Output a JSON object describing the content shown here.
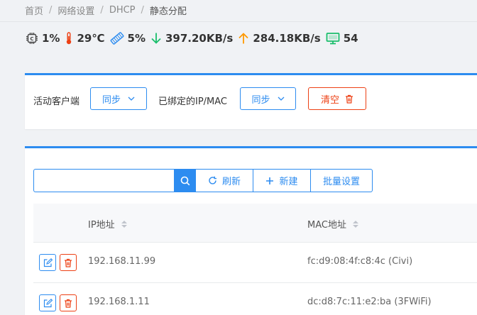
{
  "breadcrumb": [
    "首页",
    "网络设置",
    "DHCP",
    "静态分配"
  ],
  "stats": {
    "cpu": "1%",
    "temp": "29℃",
    "mem": "5%",
    "download": "397.20KB/s",
    "upload": "284.18KB/s",
    "clients": "54"
  },
  "filters": {
    "active_label": "活动客户端",
    "active_sync": "同步",
    "bound_label": "已绑定的IP/MAC",
    "bound_sync": "同步",
    "clear": "清空"
  },
  "toolbar": {
    "search_value": "",
    "refresh": "刷新",
    "new": "新建",
    "batch": "批量设置"
  },
  "table": {
    "columns": [
      "IP地址",
      "MAC地址"
    ],
    "rows": [
      {
        "ip": "192.168.11.99",
        "mac": "fc:d9:08:4f:c8:4c (Civi)"
      },
      {
        "ip": "192.168.1.11",
        "mac": "dc:d8:7c:11:e2:ba (3FWiFi)"
      }
    ]
  },
  "colors": {
    "primary": "#2d8cf0",
    "danger": "#ed4014",
    "download": "#19be6b",
    "upload": "#ff9900"
  }
}
